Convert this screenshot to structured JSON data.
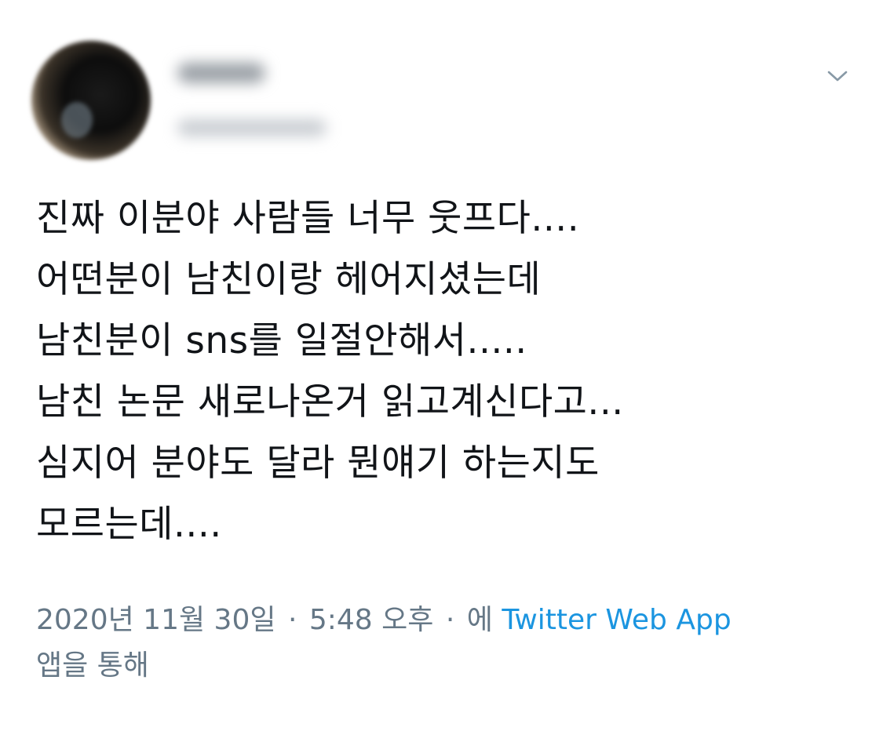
{
  "tweet": {
    "lines": [
      "진짜 이분야 사람들 너무 웃프다....",
      "어떤분이 남친이랑 헤어지셨는데",
      "남친분이 sns를 일절안해서.....",
      "남친 논문 새로나온거 읽고계신다고...",
      "심지어 분야도 달라 뭔얘기 하는지도",
      "모르는데...."
    ],
    "date": "2020년 11월 30일",
    "separator": "·",
    "time": "5:48 오후",
    "via_prefix": "에",
    "source": "Twitter Web App",
    "via_suffix": "앱을 통해"
  },
  "colors": {
    "text": "#111418",
    "meta": "#657786",
    "link": "#1b95e0"
  },
  "icons": {
    "menu": "chevron-down-icon"
  }
}
